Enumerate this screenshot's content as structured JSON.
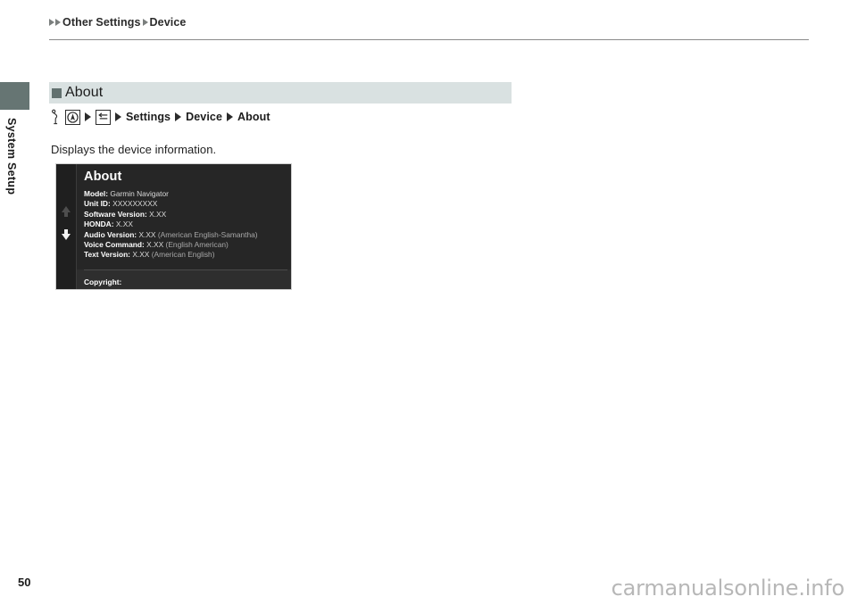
{
  "breadcrumb": {
    "items": [
      "Other Settings",
      "Device"
    ]
  },
  "sidebar": {
    "label": "System Setup"
  },
  "section": {
    "title": "About",
    "bullet_color": "#62716f",
    "bar_color": "#d9e1e1"
  },
  "nav_path": {
    "icons": [
      "hand-pointer-icon",
      "navigation-home-icon",
      "back-button-icon"
    ],
    "steps": [
      "Settings",
      "Device",
      "About"
    ]
  },
  "body": {
    "description": "Displays the device information."
  },
  "device_screen": {
    "title": "About",
    "scroll": {
      "up_arrow": "scroll-up-arrow",
      "down_arrow": "scroll-down-arrow"
    },
    "rows": [
      {
        "label": "Model:",
        "value": "Garmin Navigator",
        "note": ""
      },
      {
        "label": "Unit ID:",
        "value": "XXXXXXXXX",
        "note": ""
      },
      {
        "label": "Software Version:",
        "value": "X.XX",
        "note": ""
      },
      {
        "label": "HONDA:",
        "value": "X.XX",
        "note": ""
      },
      {
        "label": "Audio Version:",
        "value": "X.XX",
        "note": "(American English-Samantha)"
      },
      {
        "label": "Voice Command:",
        "value": "X.XX",
        "note": "(English American)"
      },
      {
        "label": "Text Version:",
        "value": "X.XX",
        "note": "(American English)"
      }
    ],
    "copyright_label": "Copyright:"
  },
  "footer": {
    "page_number": "50",
    "watermark": "carmanualsonline.info"
  }
}
